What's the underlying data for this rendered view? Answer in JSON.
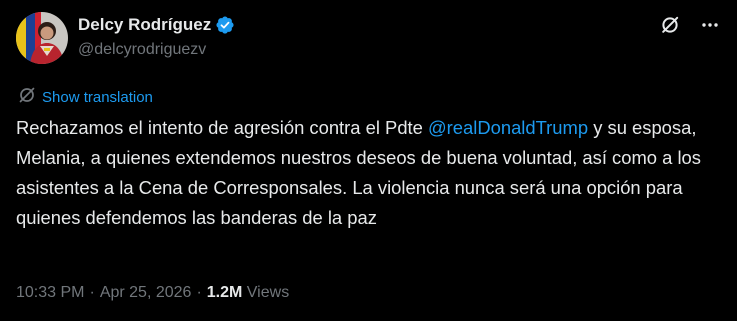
{
  "author": {
    "display_name": "Delcy Rodríguez",
    "handle": "@delcyrodriguezv",
    "verified": true,
    "avatar_icon": "profile-photo",
    "verified_icon": "verified-badge-icon",
    "verified_color": "#1d9bf0"
  },
  "header_actions": [
    {
      "icon": "grok-icon"
    },
    {
      "icon": "more-icon"
    }
  ],
  "translation": {
    "label": "Show translation",
    "icon": "translate-icon",
    "color": "#1d9bf0"
  },
  "tweet": {
    "text_before": "Rechazamos el intento de agresión contra el Pdte ",
    "mention": "@realDonaldTrump",
    "text_after": " y su esposa, Melania, a quienes extendemos nuestros deseos de buena voluntad, así como a los asistentes a la Cena de Corresponsales. La violencia nunca será una opción para quienes defendemos las banderas de la paz"
  },
  "meta": {
    "time": "10:33 PM",
    "separator": "·",
    "date": "Apr 25, 2026",
    "views_count": "1.2M",
    "views_label": "Views"
  },
  "colors": {
    "background": "#000000",
    "text": "#e7e9ea",
    "secondary": "#71767b",
    "accent": "#1d9bf0"
  }
}
